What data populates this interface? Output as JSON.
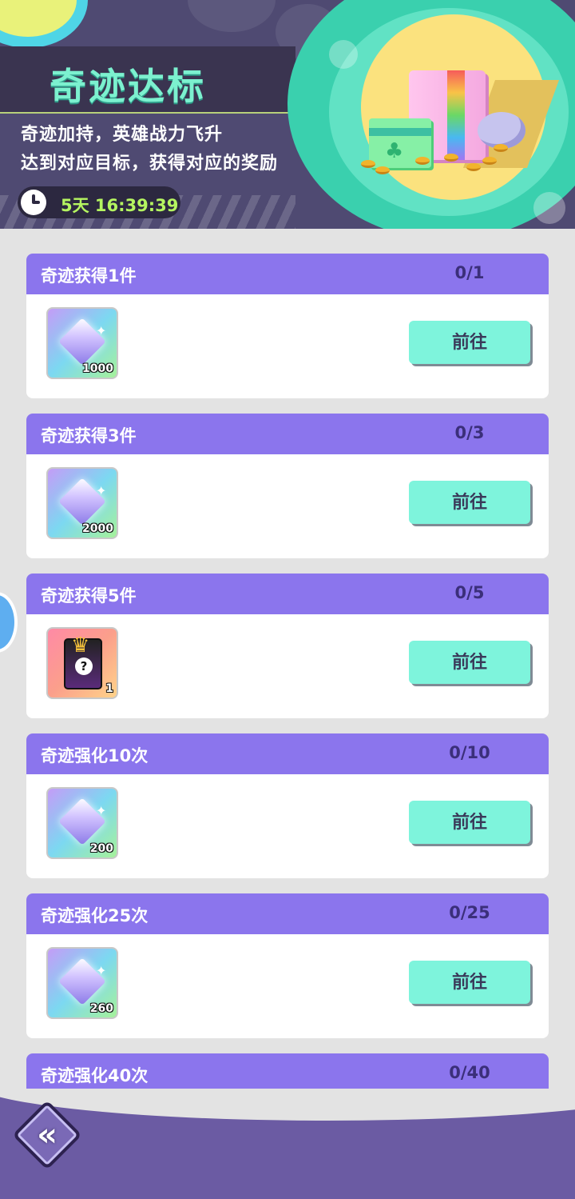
{
  "header": {
    "title": "奇迹达标",
    "subtitle_line1": "奇迹加持，英雄战力飞升",
    "subtitle_line2": "达到对应目标，获得对应的奖励",
    "timer": "5天 16:39:39"
  },
  "colors": {
    "accent_title": "#7cf1cf",
    "card_header": "#8b75ed",
    "go_button": "#7ef4dc",
    "timer_text": "#b5f560"
  },
  "tasks": [
    {
      "title": "奇迹获得1件",
      "progress": "0/1",
      "reward_icon": "gem-icon",
      "reward_qty": "1000",
      "button": "前往"
    },
    {
      "title": "奇迹获得3件",
      "progress": "0/3",
      "reward_icon": "gem-icon",
      "reward_qty": "2000",
      "button": "前往"
    },
    {
      "title": "奇迹获得5件",
      "progress": "0/5",
      "reward_icon": "mystery-card-icon",
      "reward_qty": "1",
      "button": "前往"
    },
    {
      "title": "奇迹强化10次",
      "progress": "0/10",
      "reward_icon": "gem-icon",
      "reward_qty": "200",
      "button": "前往"
    },
    {
      "title": "奇迹强化25次",
      "progress": "0/25",
      "reward_icon": "gem-icon",
      "reward_qty": "260",
      "button": "前往"
    },
    {
      "title": "奇迹强化40次",
      "progress": "0/40"
    }
  ],
  "footer": {
    "back_icon": "double-chevron-left-icon"
  }
}
